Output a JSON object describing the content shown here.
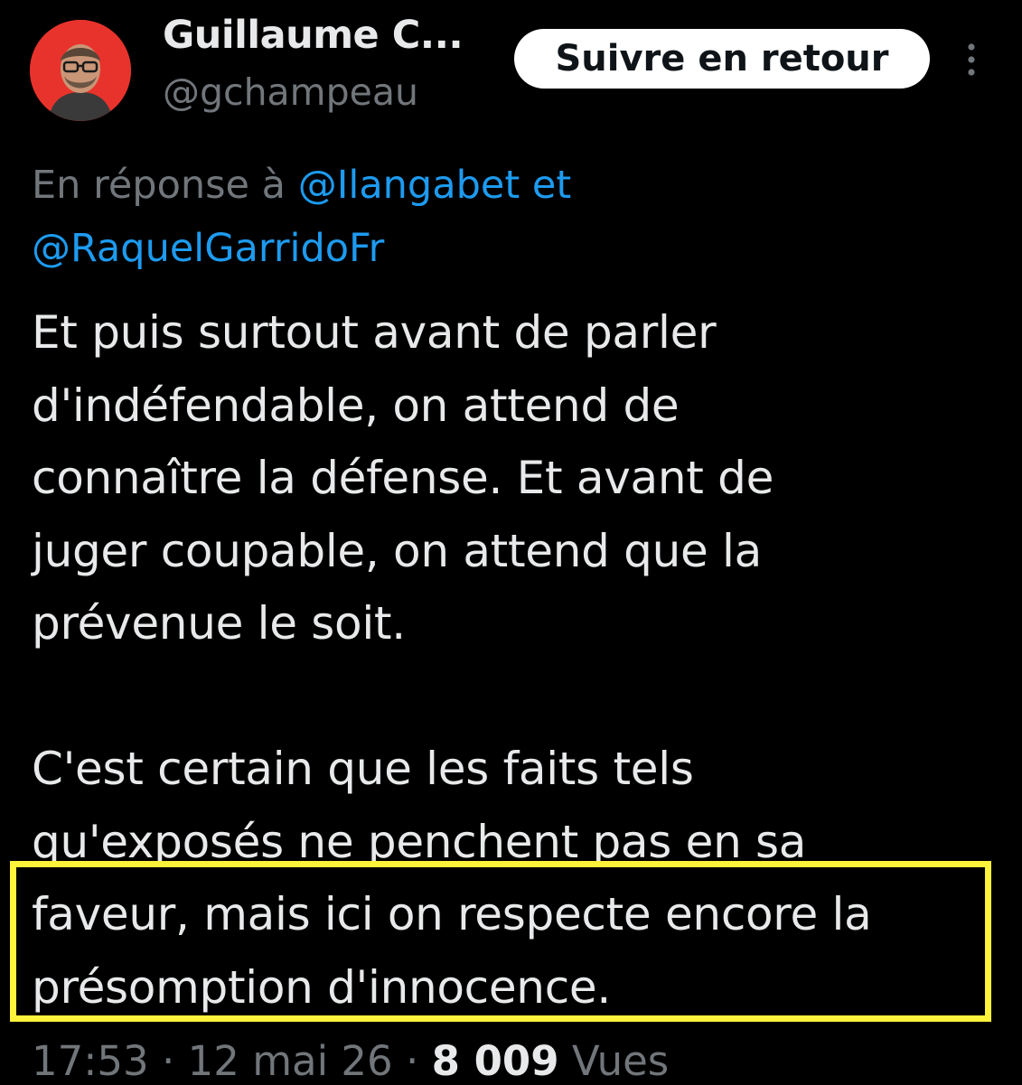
{
  "author": {
    "display_name": "Guillaume C...",
    "handle": "@gchampeau",
    "avatar_color": "#e8332c"
  },
  "follow_button": {
    "label": "Suivre en retour"
  },
  "more_icon": "vertical-dots-icon",
  "reply": {
    "prefix": "En réponse à",
    "mention_1": "@Ilangabet",
    "conjunction": "et",
    "mention_2": "@RaquelGarridoFr"
  },
  "tweet": {
    "paragraph_1": [
      "Et puis surtout avant de parler",
      "d'indéfendable, on attend de",
      "connaître la défense. Et avant de",
      "juger coupable, on attend que la",
      "prévenue le soit."
    ],
    "paragraph_2": [
      "C'est certain que les faits tels",
      "qu'exposés ne penchent pas en sa",
      "faveur, mais ici on respecte encore la",
      "présomption d'innocence."
    ]
  },
  "meta": {
    "time": "17:53",
    "separator": "·",
    "date": "12 mai 26",
    "views_count": "8 009",
    "views_label": "Vues"
  },
  "colors": {
    "background": "#000000",
    "text": "#e7e9ea",
    "secondary": "#71767b",
    "link": "#1d9bf0",
    "highlight": "#fff23a"
  }
}
